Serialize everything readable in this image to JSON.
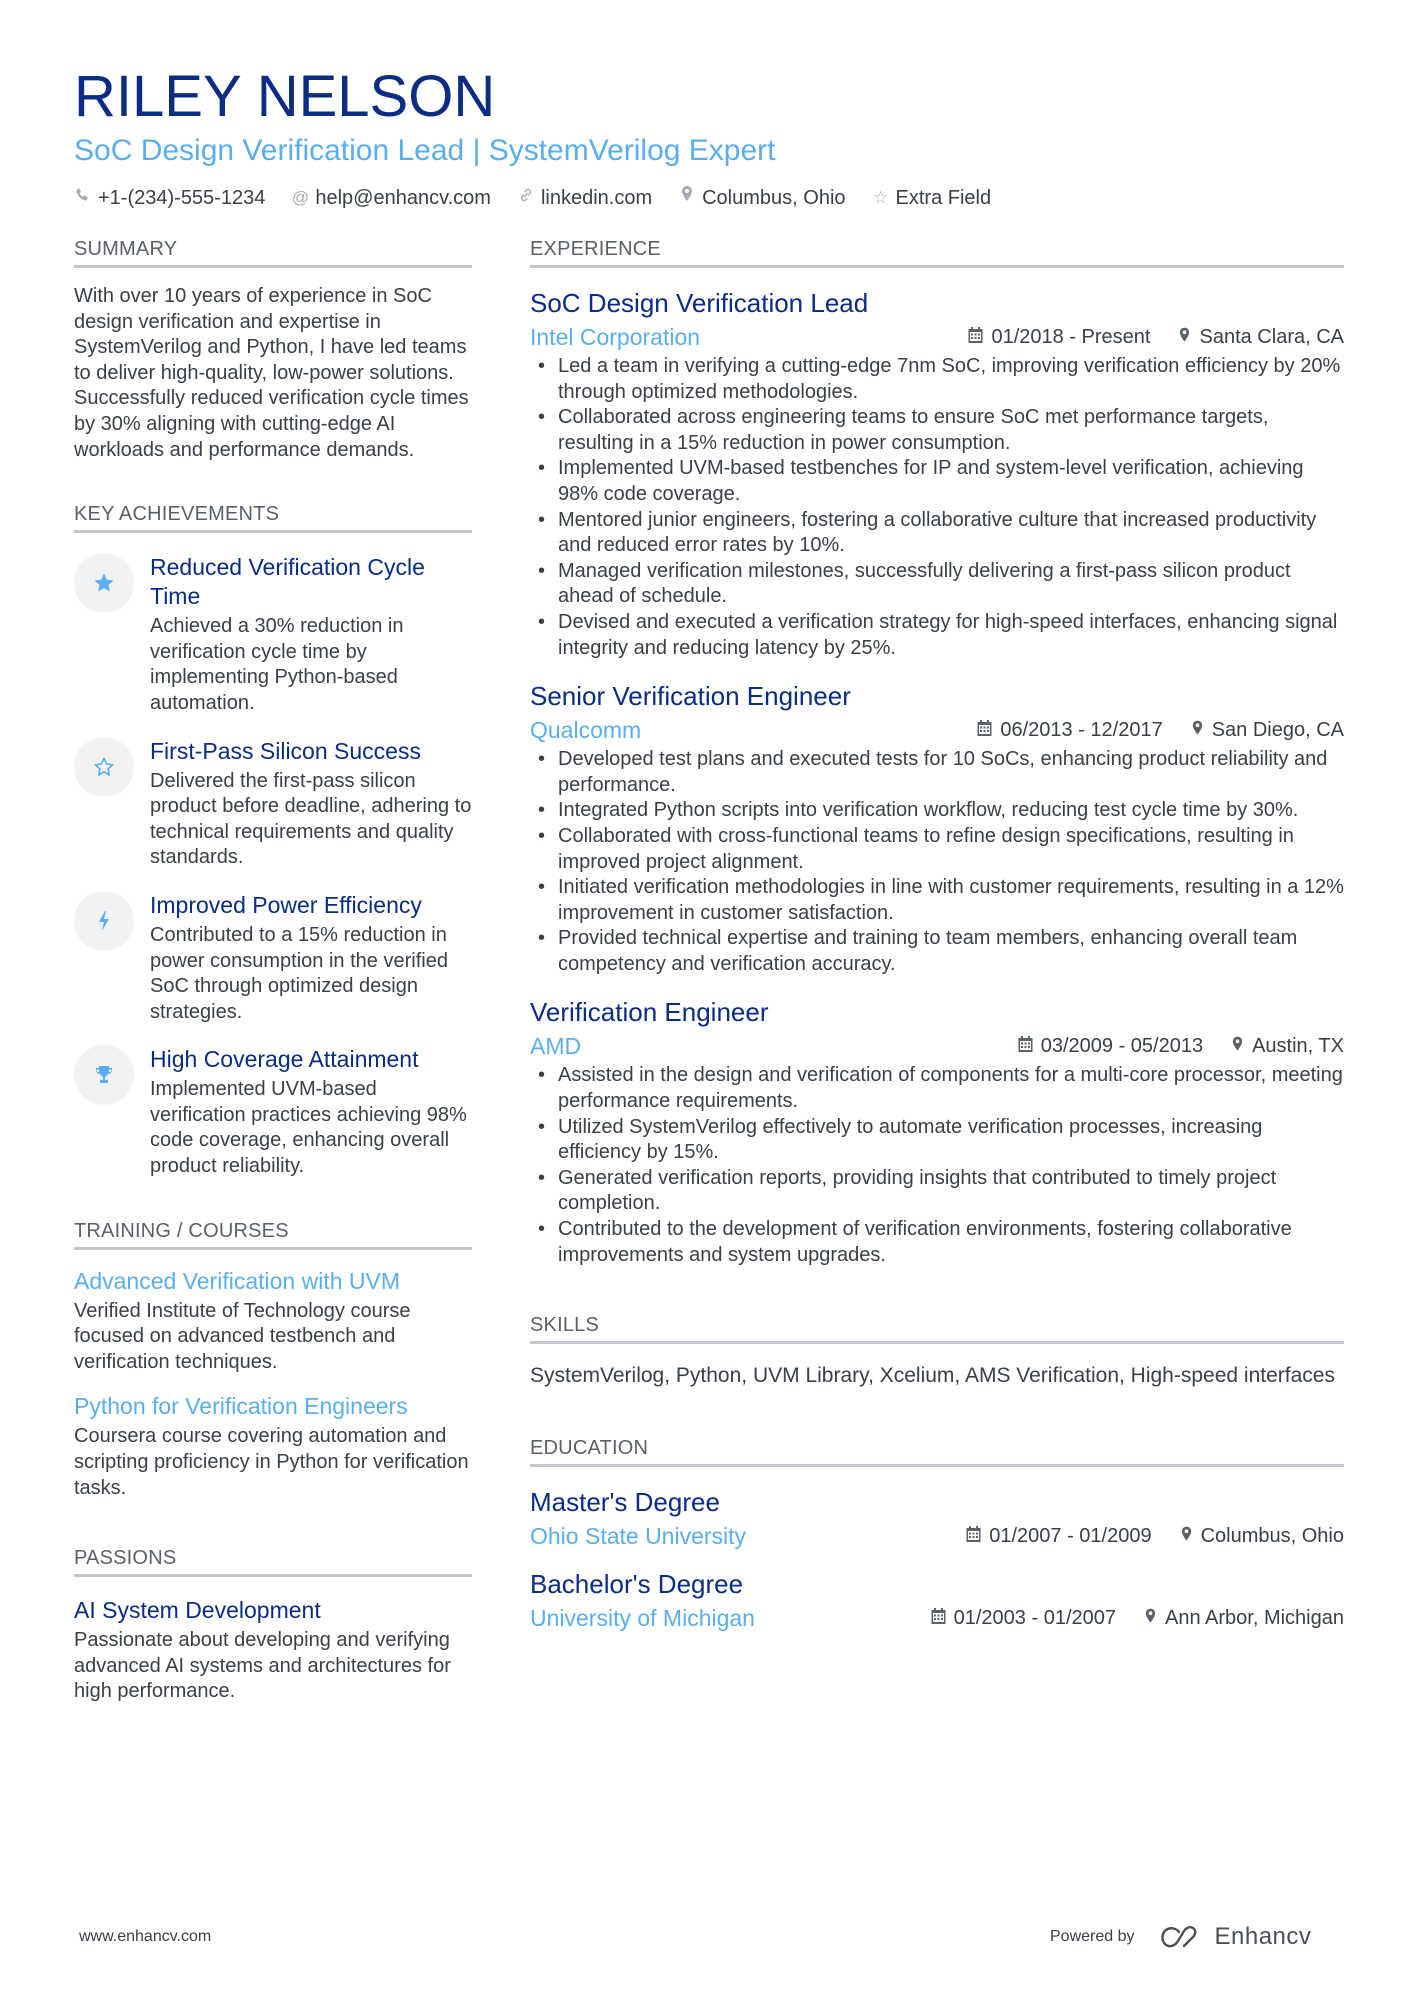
{
  "header": {
    "name": "RILEY NELSON",
    "subtitle": "SoC Design Verification Lead | SystemVerilog Expert",
    "contacts": [
      {
        "icon": "phone-icon",
        "glyph": "✆",
        "text": "+1-(234)-555-1234"
      },
      {
        "icon": "at-icon",
        "glyph": "@",
        "text": "help@enhancv.com"
      },
      {
        "icon": "link-icon",
        "glyph": "🔗",
        "text": "linkedin.com"
      },
      {
        "icon": "location-pin-icon",
        "glyph": "●",
        "text": "Columbus, Ohio"
      },
      {
        "icon": "star-outline-icon",
        "glyph": "☆",
        "text": "Extra Field"
      }
    ]
  },
  "summary": {
    "title": "SUMMARY",
    "text": "With over 10 years of experience in SoC design verification and expertise in SystemVerilog and Python, I have led teams to deliver high-quality, low-power solutions. Successfully reduced verification cycle times by 30% aligning with cutting-edge AI workloads and performance demands."
  },
  "achievements": {
    "title": "KEY ACHIEVEMENTS",
    "items": [
      {
        "icon": "star-filled-icon",
        "glyph": "★",
        "title": "Reduced Verification Cycle Time",
        "desc": "Achieved a 30% reduction in verification cycle time by implementing Python-based automation."
      },
      {
        "icon": "star-outline-icon",
        "glyph": "☆",
        "title": "First-Pass Silicon Success",
        "desc": "Delivered the first-pass silicon product before deadline, adhering to technical requirements and quality standards."
      },
      {
        "icon": "lightning-bolt-icon",
        "glyph": "ϟ",
        "title": "Improved Power Efficiency",
        "desc": "Contributed to a 15% reduction in power consumption in the verified SoC through optimized design strategies."
      },
      {
        "icon": "trophy-icon",
        "glyph": "🏆",
        "title": "High Coverage Attainment",
        "desc": "Implemented UVM-based verification practices achieving 98% code coverage, enhancing overall product reliability."
      }
    ]
  },
  "training": {
    "title": "TRAINING / COURSES",
    "items": [
      {
        "title": "Advanced Verification with UVM",
        "desc": "Verified Institute of Technology course focused on advanced testbench and verification techniques."
      },
      {
        "title": "Python for Verification Engineers",
        "desc": "Coursera course covering automation and scripting proficiency in Python for verification tasks."
      }
    ]
  },
  "passions": {
    "title": "PASSIONS",
    "items": [
      {
        "title": "AI System Development",
        "desc": "Passionate about developing and verifying advanced AI systems and architectures for high performance."
      }
    ]
  },
  "experience": {
    "title": "EXPERIENCE",
    "jobs": [
      {
        "title": "SoC Design Verification Lead",
        "company": "Intel Corporation",
        "dates": "01/2018 - Present",
        "location": "Santa Clara, CA",
        "bullets": [
          "Led a team in verifying a cutting-edge 7nm SoC, improving verification efficiency by 20% through optimized methodologies.",
          "Collaborated across engineering teams to ensure SoC met performance targets, resulting in a 15% reduction in power consumption.",
          "Implemented UVM-based testbenches for IP and system-level verification, achieving 98% code coverage.",
          "Mentored junior engineers, fostering a collaborative culture that increased productivity and reduced error rates by 10%.",
          "Managed verification milestones, successfully delivering a first-pass silicon product ahead of schedule.",
          "Devised and executed a verification strategy for high-speed interfaces, enhancing signal integrity and reducing latency by 25%."
        ]
      },
      {
        "title": "Senior Verification Engineer",
        "company": "Qualcomm",
        "dates": "06/2013 - 12/2017",
        "location": "San Diego, CA",
        "bullets": [
          "Developed test plans and executed tests for 10 SoCs, enhancing product reliability and performance.",
          "Integrated Python scripts into verification workflow, reducing test cycle time by 30%.",
          "Collaborated with cross-functional teams to refine design specifications, resulting in improved project alignment.",
          "Initiated verification methodologies in line with customer requirements, resulting in a 12% improvement in customer satisfaction.",
          "Provided technical expertise and training to team members, enhancing overall team competency and verification accuracy."
        ]
      },
      {
        "title": "Verification Engineer",
        "company": "AMD",
        "dates": "03/2009 - 05/2013",
        "location": "Austin, TX",
        "bullets": [
          "Assisted in the design and verification of components for a multi-core processor, meeting performance requirements.",
          "Utilized SystemVerilog effectively to automate verification processes, increasing efficiency by 15%.",
          "Generated verification reports, providing insights that contributed to timely project completion.",
          "Contributed to the development of verification environments, fostering collaborative improvements and system upgrades."
        ]
      }
    ]
  },
  "skills": {
    "title": "SKILLS",
    "text": "SystemVerilog, Python, UVM Library, Xcelium, AMS Verification, High-speed interfaces"
  },
  "education": {
    "title": "EDUCATION",
    "items": [
      {
        "degree": "Master's Degree",
        "school": "Ohio State University",
        "dates": "01/2007 - 01/2009",
        "location": "Columbus, Ohio"
      },
      {
        "degree": "Bachelor's Degree",
        "school": "University of Michigan",
        "dates": "01/2003 - 01/2007",
        "location": "Ann Arbor, Michigan"
      }
    ]
  },
  "footer": {
    "website": "www.enhancv.com",
    "powered_by": "Powered by",
    "brand": "Enhancv"
  },
  "colors": {
    "name": "#0a2c84",
    "accent": "#5aaef0",
    "text": "#3a4047",
    "section_rule": "#c3c6ca"
  }
}
